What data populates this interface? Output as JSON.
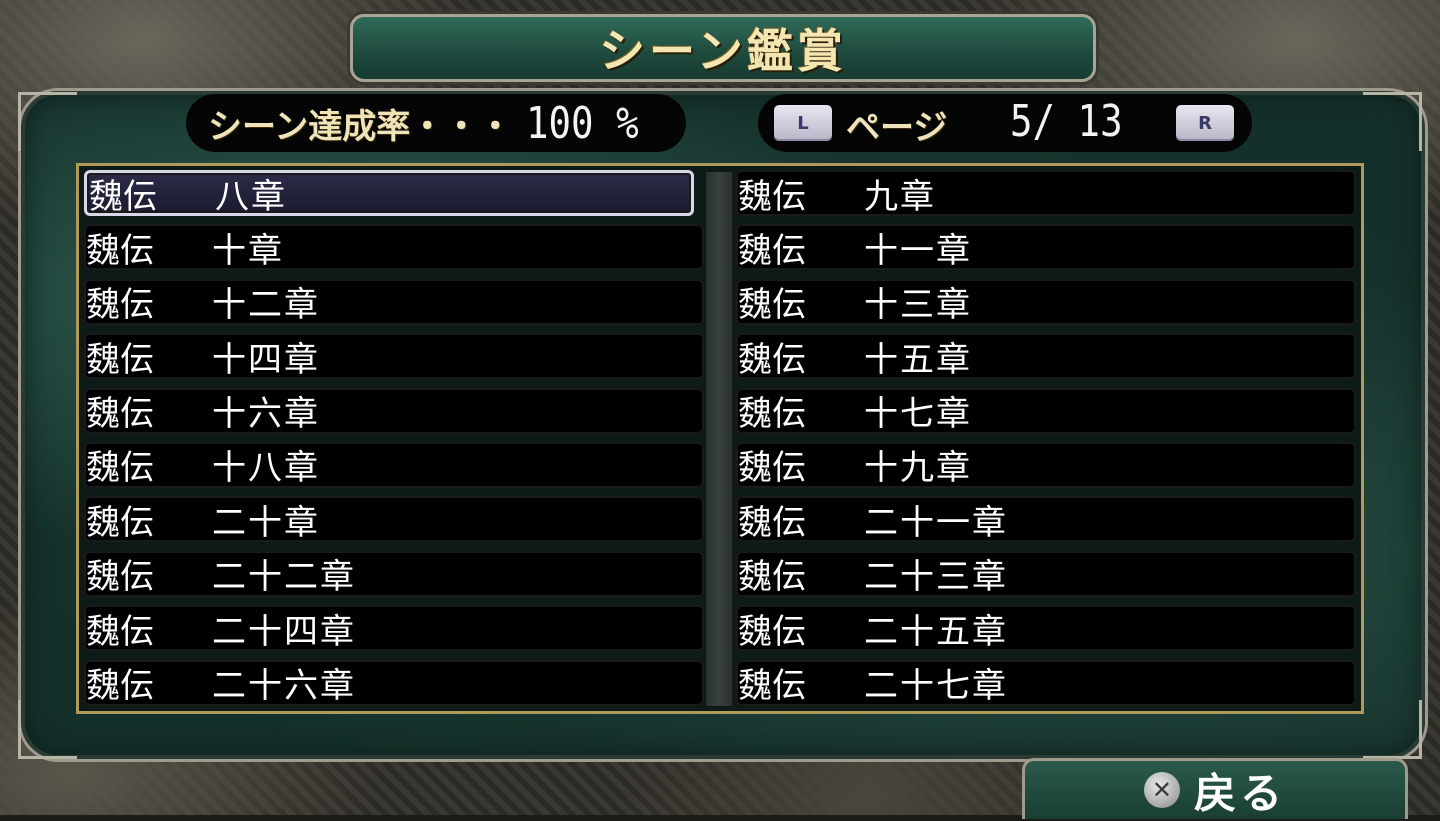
{
  "header": {
    "title": "シーン鑑賞"
  },
  "completion": {
    "label": "シーン達成率・・・",
    "value": "100 %"
  },
  "pager": {
    "l_key": "L",
    "r_key": "R",
    "label": "ページ",
    "value": "5/ 13"
  },
  "entries": {
    "left": [
      {
        "prefix": "魏伝",
        "chapter": "八章",
        "selected": true
      },
      {
        "prefix": "魏伝",
        "chapter": "十章"
      },
      {
        "prefix": "魏伝",
        "chapter": "十二章"
      },
      {
        "prefix": "魏伝",
        "chapter": "十四章"
      },
      {
        "prefix": "魏伝",
        "chapter": "十六章"
      },
      {
        "prefix": "魏伝",
        "chapter": "十八章"
      },
      {
        "prefix": "魏伝",
        "chapter": "二十章"
      },
      {
        "prefix": "魏伝",
        "chapter": "二十二章"
      },
      {
        "prefix": "魏伝",
        "chapter": "二十四章"
      },
      {
        "prefix": "魏伝",
        "chapter": "二十六章"
      }
    ],
    "right": [
      {
        "prefix": "魏伝",
        "chapter": "九章"
      },
      {
        "prefix": "魏伝",
        "chapter": "十一章"
      },
      {
        "prefix": "魏伝",
        "chapter": "十三章"
      },
      {
        "prefix": "魏伝",
        "chapter": "十五章"
      },
      {
        "prefix": "魏伝",
        "chapter": "十七章"
      },
      {
        "prefix": "魏伝",
        "chapter": "十九章"
      },
      {
        "prefix": "魏伝",
        "chapter": "二十一章"
      },
      {
        "prefix": "魏伝",
        "chapter": "二十三章"
      },
      {
        "prefix": "魏伝",
        "chapter": "二十五章"
      },
      {
        "prefix": "魏伝",
        "chapter": "二十七章"
      }
    ]
  },
  "footer": {
    "back_icon": "cross-button-icon",
    "back_label": "戻る"
  }
}
